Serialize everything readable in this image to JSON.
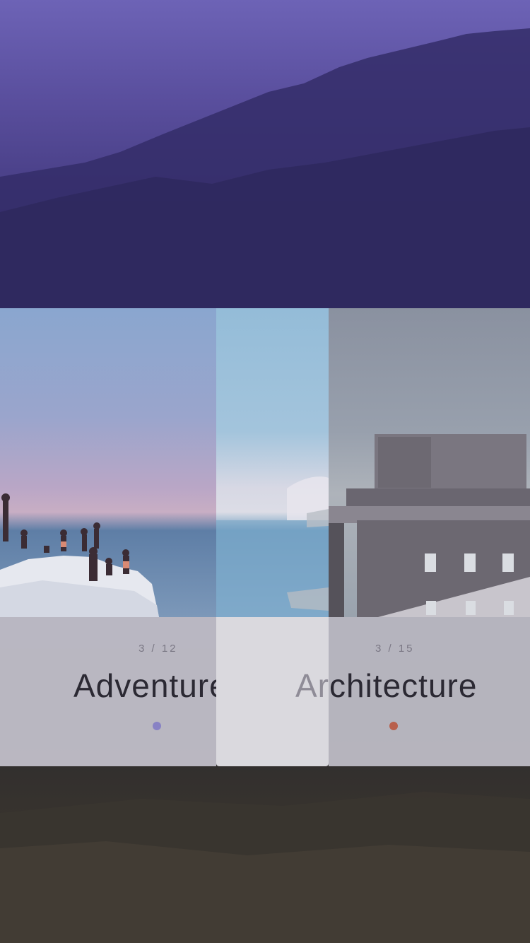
{
  "colors": {
    "accent_purple": "#6d63b6",
    "dot_adventure": "#8882c4",
    "dot_architecture": "#b8604c"
  },
  "cards": [
    {
      "counter": "3 / 12",
      "title": "Adventure"
    },
    {
      "counter": "3 / 15",
      "title": "Architecture",
      "title_prefix": "Ar",
      "title_rest": "chitecture"
    }
  ],
  "icons": [
    "pagination-dot-adventure",
    "pagination-dot-architecture"
  ]
}
